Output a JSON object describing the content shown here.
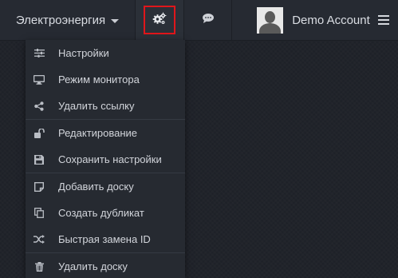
{
  "topbar": {
    "dashboard_name": "Электроэнергия",
    "account_name": "Demo Account"
  },
  "icons": {
    "dashboard_caret": "caret-down-icon",
    "settings": "gears-icon",
    "chat": "chat-bubble-icon",
    "avatar": "default-user-avatar",
    "menu": "hamburger-icon"
  },
  "colors": {
    "highlight_border": "#e0161b",
    "topbar_bg": "#262a32",
    "menu_bg": "#262a31"
  },
  "menu": {
    "groups": [
      {
        "items": [
          {
            "label": "Настройки",
            "icon": "sliders-icon"
          },
          {
            "label": "Режим монитора",
            "icon": "monitor-icon"
          },
          {
            "label": "Удалить ссылку",
            "icon": "share-icon"
          }
        ]
      },
      {
        "items": [
          {
            "label": "Редактирование",
            "icon": "unlock-icon"
          },
          {
            "label": "Сохранить настройки",
            "icon": "floppy-disk-icon"
          }
        ]
      },
      {
        "items": [
          {
            "label": "Добавить доску",
            "icon": "sticky-note-icon"
          },
          {
            "label": "Создать дубликат",
            "icon": "copy-icon"
          },
          {
            "label": "Быстрая замена ID",
            "icon": "shuffle-icon"
          }
        ]
      },
      {
        "items": [
          {
            "label": "Удалить доску",
            "icon": "trash-icon"
          }
        ]
      }
    ]
  }
}
